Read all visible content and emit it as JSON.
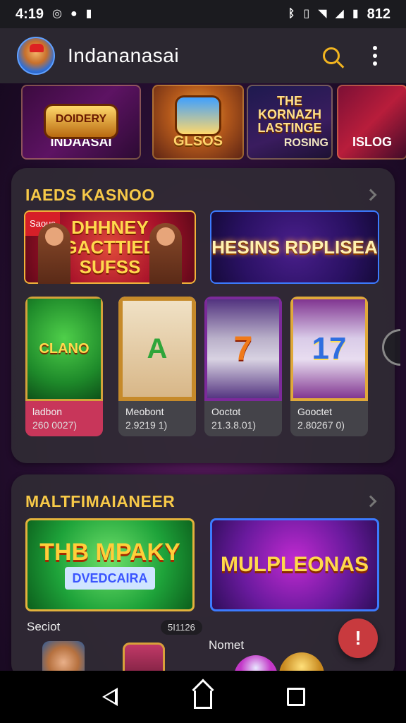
{
  "status_bar": {
    "time": "4:19",
    "battery_text": "812"
  },
  "app_bar": {
    "title": "Indananasai"
  },
  "top_strip": {
    "tiles": [
      {
        "title": "DOIDERY",
        "label": "INDAASAI"
      },
      {
        "label": "GLSOS"
      },
      {
        "title": "THE KORNAZH LASTINGE",
        "label": "ROSING"
      },
      {
        "label": "ISLOG"
      }
    ]
  },
  "section_1": {
    "title": "IAEDS KASNOO",
    "banners": [
      {
        "tag": "Saous",
        "text": "DHHNEY GACTTIED SUFSS"
      },
      {
        "text": "HESINS RDPLISEA"
      }
    ],
    "games": [
      {
        "art_text": "CLANO",
        "name": "ladbon",
        "value": "260 0027)"
      },
      {
        "art_text": "A",
        "name": "Meobont",
        "value": "2.9219 1)"
      },
      {
        "art_text": "7",
        "name": "Ooctot",
        "value": "21.3.8.01)"
      },
      {
        "art_text": "17",
        "name": "Gooctet",
        "value": "2.80267 0)"
      }
    ]
  },
  "section_2": {
    "title": "MALTFIMAIANEER",
    "banners": [
      {
        "text": "THB MPAKY",
        "sub": "DVEDCAIRA"
      },
      {
        "text": "MULPLEONAS"
      }
    ],
    "sub_left_label": "Seciot",
    "sub_badge": "5I1126",
    "sub_right_label": "Nomet"
  },
  "fab": {
    "label": "!"
  },
  "colors": {
    "accent_gold": "#f7c948",
    "fab_red": "#c83a3e",
    "app_bar_bg": "#2b2730"
  }
}
